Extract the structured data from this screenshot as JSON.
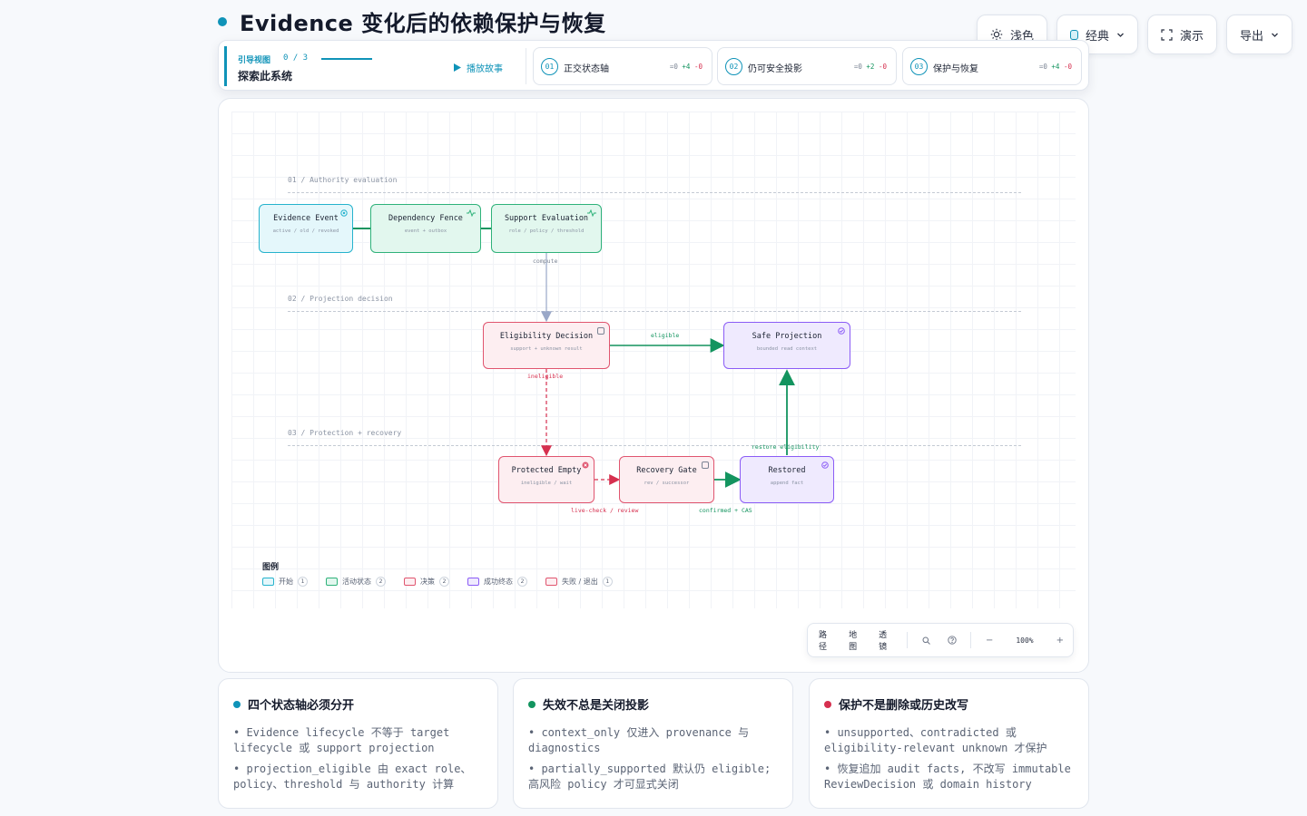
{
  "title": "Evidence 变化后的依赖保护与恢复",
  "colors": {
    "accent": "#0f93b8",
    "green": "#13945f",
    "red": "#d6304f",
    "purple": "#8b5cf6"
  },
  "toolbar": {
    "theme_label": "浅色",
    "style_label": "经典",
    "present_label": "演示",
    "export_label": "导出"
  },
  "guide": {
    "label": "引导视图",
    "count": "0 / 3",
    "subtitle": "探索此系统",
    "play_label": "播放故事",
    "steps": [
      {
        "num": "01",
        "label": "正交状态轴",
        "delta": [
          "=0",
          "+4",
          "-0"
        ]
      },
      {
        "num": "02",
        "label": "仍可安全投影",
        "delta": [
          "=0",
          "+2",
          "-0"
        ]
      },
      {
        "num": "03",
        "label": "保护与恢复",
        "delta": [
          "=0",
          "+4",
          "-0"
        ]
      }
    ]
  },
  "diagram": {
    "lanes": [
      "01 / Authority evaluation",
      "02 / Projection decision",
      "03 / Protection + recovery"
    ],
    "nodes": {
      "evidence_event": {
        "title": "Evidence Event",
        "sub": "active / old / revoked"
      },
      "dependency_fence": {
        "title": "Dependency Fence",
        "sub": "event + outbox"
      },
      "support_evaluation": {
        "title": "Support Evaluation",
        "sub": "role / policy / threshold"
      },
      "eligibility_decision": {
        "title": "Eligibility Decision",
        "sub": "support + unknown result"
      },
      "safe_projection": {
        "title": "Safe Projection",
        "sub": "bounded read context"
      },
      "protected_empty": {
        "title": "Protected Empty",
        "sub": "ineligible / wait"
      },
      "recovery_gate": {
        "title": "Recovery Gate",
        "sub": "rev / successor"
      },
      "restored": {
        "title": "Restored",
        "sub": "append fact"
      }
    },
    "edges": {
      "compute": "compute",
      "eligible": "eligible",
      "ineligible": "ineligible",
      "restore": "restore eligibility",
      "live_check": "live-check / review",
      "confirmed": "confirmed + CAS"
    }
  },
  "legend": {
    "title": "图例",
    "items": [
      {
        "label": "开始",
        "count": "1"
      },
      {
        "label": "活动状态",
        "count": "2"
      },
      {
        "label": "决策",
        "count": "2"
      },
      {
        "label": "成功终态",
        "count": "2"
      },
      {
        "label": "失败 / 退出",
        "count": "1"
      }
    ]
  },
  "view_toolbar": {
    "tabs": [
      "路径",
      "地图",
      "透镜"
    ],
    "zoom": "100%",
    "minus": "−",
    "plus": "+"
  },
  "cards": [
    {
      "title": "四个状态轴必须分开",
      "items": [
        "• Evidence lifecycle 不等于 target lifecycle 或 support projection",
        "• projection_eligible 由 exact role、policy、threshold 与 authority 计算"
      ]
    },
    {
      "title": "失效不总是关闭投影",
      "items": [
        "• context_only 仅进入 provenance 与 diagnostics",
        "• partially_supported 默认仍 eligible; 高风险 policy 才可显式关闭"
      ]
    },
    {
      "title": "保护不是删除或历史改写",
      "items": [
        "• unsupported、contradicted 或 eligibility-relevant unknown 才保护",
        "• 恢复追加 audit facts, 不改写 immutable ReviewDecision 或 domain history"
      ]
    }
  ]
}
